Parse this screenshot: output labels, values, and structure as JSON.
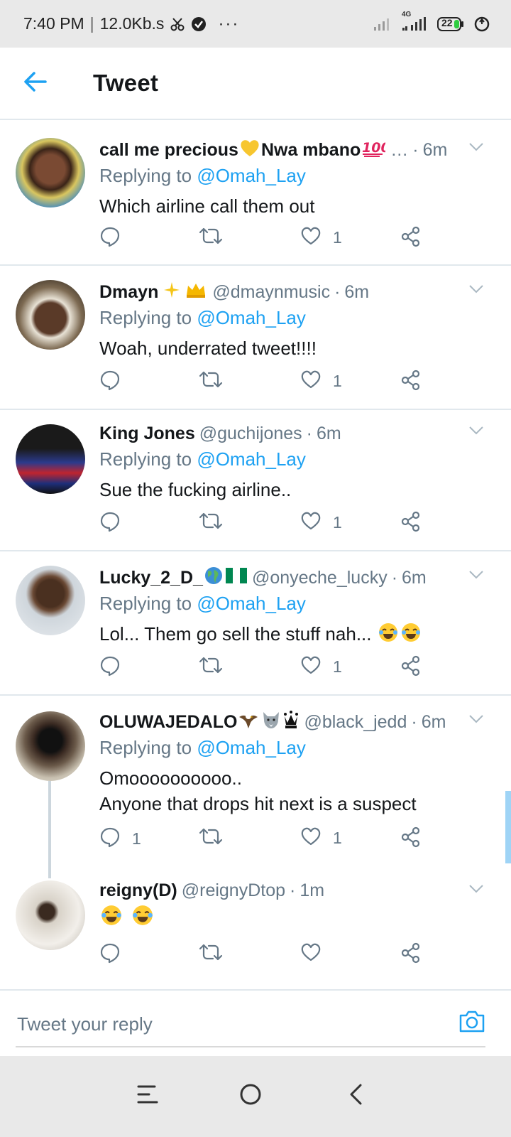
{
  "status_bar": {
    "time": "7:40 PM",
    "separator": "|",
    "speed": "12.0Kb.s",
    "more": "···",
    "network": "4G",
    "battery": "22"
  },
  "header": {
    "title": "Tweet"
  },
  "tweets": [
    {
      "name": "call me precious",
      "name_suffix": "Nwa mbano",
      "handle": "…",
      "time": "6m",
      "replying_label": "Replying to",
      "replying_to": "@Omah_Lay",
      "text": "Which airline call them out",
      "reply_count": "",
      "retweet_count": "",
      "like_count": "1"
    },
    {
      "name": "Dmayn",
      "handle": "@dmaynmusic",
      "time": "6m",
      "replying_label": "Replying to",
      "replying_to": "@Omah_Lay",
      "text": "Woah, underrated tweet!!!!",
      "reply_count": "",
      "retweet_count": "",
      "like_count": "1"
    },
    {
      "name": "King Jones",
      "handle": "@guchijones",
      "time": "6m",
      "replying_label": "Replying to",
      "replying_to": "@Omah_Lay",
      "text": "Sue the fucking airline..",
      "reply_count": "",
      "retweet_count": "",
      "like_count": "1"
    },
    {
      "name": "Lucky_2_D_",
      "handle": "@onyeche_lucky",
      "time": "6m",
      "replying_label": "Replying to",
      "replying_to": "@Omah_Lay",
      "text": "Lol...  Them go sell the stuff nah...",
      "reply_count": "",
      "retweet_count": "",
      "like_count": "1"
    },
    {
      "name": "OLUWAJEDALO",
      "handle": "@black_jedd",
      "time": "6m",
      "replying_label": "Replying to",
      "replying_to": "@Omah_Lay",
      "text_line1": "Omoooooooooo..",
      "text_line2": "Anyone that drops hit next is a suspect",
      "reply_count": "1",
      "retweet_count": "",
      "like_count": "1"
    },
    {
      "name": "reigny(D)",
      "handle": "@reignyDtop",
      "time": "1m",
      "reply_count": "",
      "retweet_count": "",
      "like_count": ""
    }
  ],
  "composer": {
    "placeholder": "Tweet your reply"
  },
  "icons": {
    "back": "arrow-left-icon",
    "caret": "chevron-down-icon",
    "reply": "speech-bubble-icon",
    "retweet": "retweet-icon",
    "like": "heart-icon",
    "share": "share-icon",
    "camera": "camera-icon"
  },
  "colors": {
    "accent": "#1da1f2",
    "text_primary": "#14171a",
    "text_secondary": "#657786",
    "divider": "#e1e8ed"
  }
}
